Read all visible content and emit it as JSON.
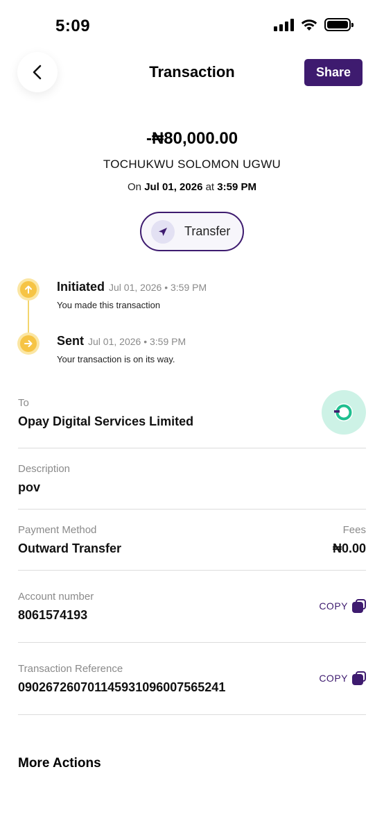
{
  "status_bar": {
    "time": "5:09"
  },
  "header": {
    "title": "Transaction",
    "share_label": "Share"
  },
  "summary": {
    "amount": "-₦80,000.00",
    "recipient": "TOCHUKWU SOLOMON UGWU",
    "date_prefix": "On",
    "date": "Jul 01, 2026",
    "date_connector": "at",
    "time": "3:59 PM",
    "type": "Transfer"
  },
  "timeline": [
    {
      "title": "Initiated",
      "time": "Jul 01, 2026 • 3:59 PM",
      "description": "You made this transaction"
    },
    {
      "title": "Sent",
      "time": "Jul 01, 2026 • 3:59 PM",
      "description": "Your transaction is on its way."
    }
  ],
  "details": {
    "to_label": "To",
    "to_value": "Opay Digital Services Limited",
    "description_label": "Description",
    "description_value": "pov",
    "payment_method_label": "Payment Method",
    "payment_method_value": "Outward Transfer",
    "fees_label": "Fees",
    "fees_value": "₦0.00",
    "account_label": "Account number",
    "account_value": "8061574193",
    "reference_label": "Transaction Reference",
    "reference_value": "090267260701145931096007565241",
    "copy_label": "COPY"
  },
  "more_actions_label": "More Actions",
  "colors": {
    "brand": "#3e1b6f",
    "timeline": "#f6c445",
    "opay_green": "#1fbf8f"
  },
  "icons": [
    "chevron-left-icon",
    "send-icon",
    "arrow-up-icon",
    "arrow-right-icon",
    "opay-logo-icon",
    "copy-icon"
  ]
}
